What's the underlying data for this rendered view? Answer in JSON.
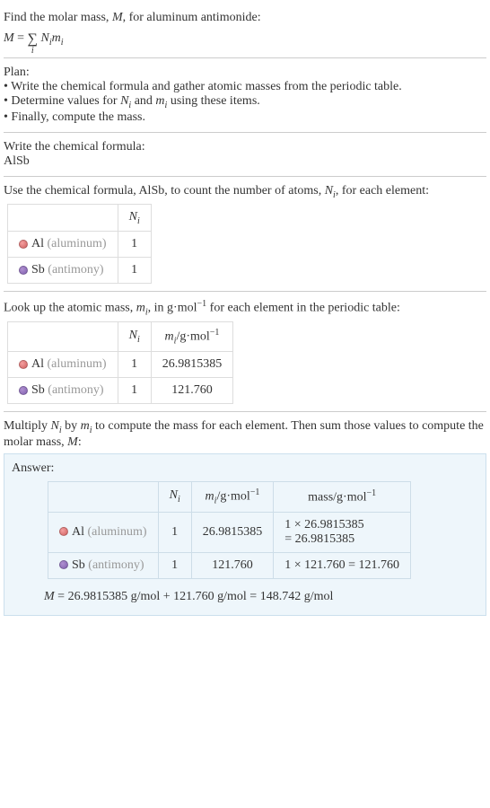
{
  "intro": {
    "line1_pre": "Find the molar mass, ",
    "line1_var": "M",
    "line1_post": ", for aluminum antimonide:",
    "formula_lhs": "M",
    "formula_eq": " = ",
    "formula_rhs_nm": "N",
    "formula_rhs_m": "m",
    "sigma": "∑",
    "sub_i": "i"
  },
  "plan": {
    "header": "Plan:",
    "item1": "• Write the chemical formula and gather atomic masses from the periodic table.",
    "item2_pre": "• Determine values for ",
    "item2_n": "N",
    "item2_mid": " and ",
    "item2_m": "m",
    "item2_post": " using these items.",
    "item3": "• Finally, compute the mass."
  },
  "chem": {
    "header": "Write the chemical formula:",
    "formula": "AlSb"
  },
  "count_section": {
    "text_pre": "Use the chemical formula, AlSb, to count the number of atoms, ",
    "text_var": "N",
    "text_post": ", for each element:",
    "col_n": "N",
    "row_al_el": "Al",
    "row_al_paren": " (aluminum)",
    "row_al_n": "1",
    "row_sb_el": "Sb",
    "row_sb_paren": " (antimony)",
    "row_sb_n": "1"
  },
  "lookup_section": {
    "text_pre": "Look up the atomic mass, ",
    "text_var": "m",
    "text_mid": ", in g·mol",
    "text_exp": "−1",
    "text_post": " for each element in the periodic table:",
    "col_n": "N",
    "col_m_pre": "m",
    "col_m_unit": "/g·mol",
    "col_m_exp": "−1",
    "row_al_el": "Al",
    "row_al_paren": " (aluminum)",
    "row_al_n": "1",
    "row_al_m": "26.9815385",
    "row_sb_el": "Sb",
    "row_sb_paren": " (antimony)",
    "row_sb_n": "1",
    "row_sb_m": "121.760"
  },
  "multiply_section": {
    "text_pre": "Multiply ",
    "text_n": "N",
    "text_mid1": " by ",
    "text_m": "m",
    "text_mid2": " to compute the mass for each element. Then sum those values to compute the molar mass, ",
    "text_M": "M",
    "text_post": ":"
  },
  "answer": {
    "label": "Answer:",
    "col_n": "N",
    "col_m_pre": "m",
    "col_m_unit": "/g·mol",
    "col_m_exp": "−1",
    "col_mass_pre": "mass/g·mol",
    "col_mass_exp": "−1",
    "row_al_el": "Al",
    "row_al_paren": " (aluminum)",
    "row_al_n": "1",
    "row_al_m": "26.9815385",
    "row_al_mass_l1": "1 × 26.9815385",
    "row_al_mass_l2": "= 26.9815385",
    "row_sb_el": "Sb",
    "row_sb_paren": " (antimony)",
    "row_sb_n": "1",
    "row_sb_m": "121.760",
    "row_sb_mass": "1 × 121.760 = 121.760",
    "final_lhs": "M",
    "final_rest": " = 26.9815385 g/mol + 121.760 g/mol = 148.742 g/mol"
  }
}
